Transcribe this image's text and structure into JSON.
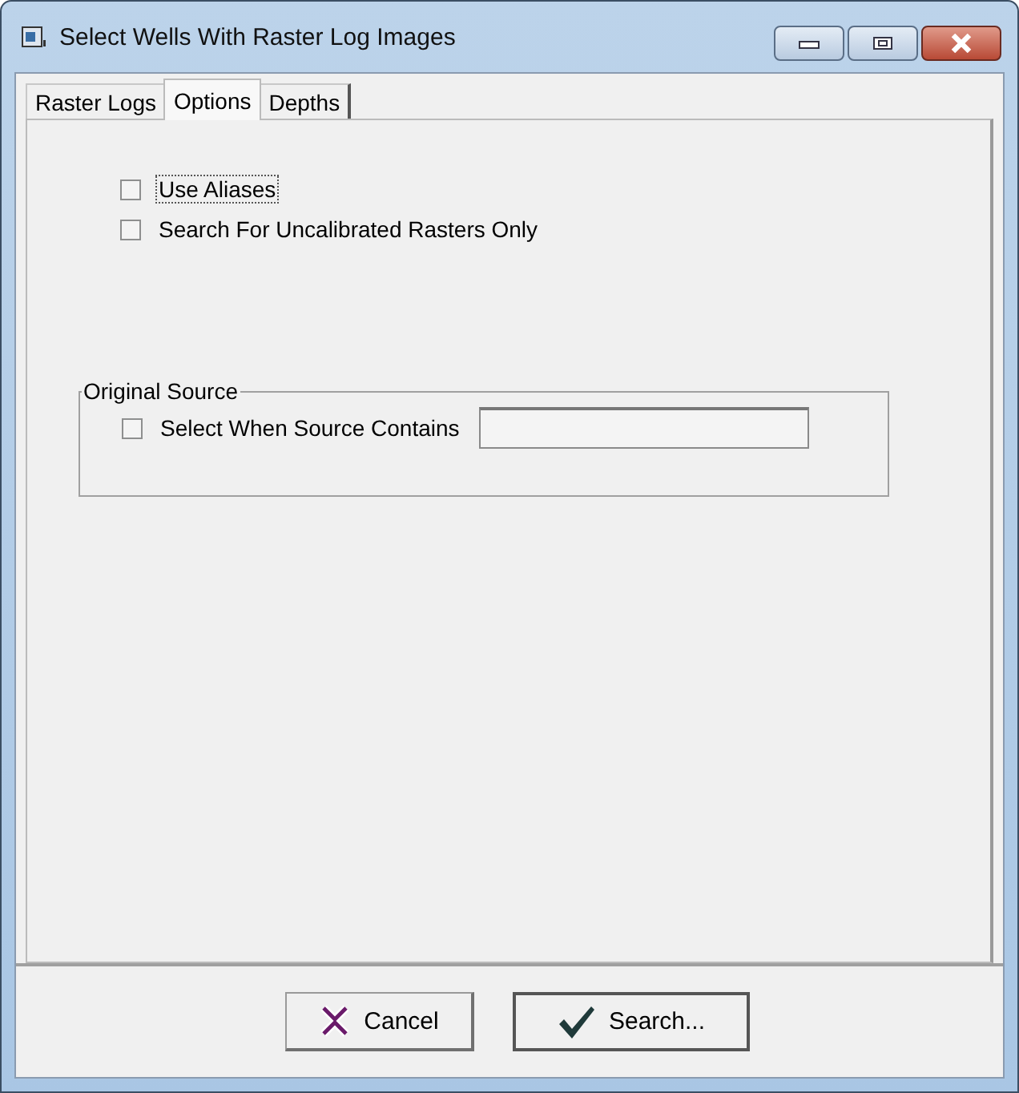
{
  "window": {
    "title": "Select Wells With Raster Log Images"
  },
  "tabs": [
    {
      "label": "Raster Logs",
      "selected": false
    },
    {
      "label": "Options",
      "selected": true
    },
    {
      "label": "Depths",
      "selected": false
    }
  ],
  "options": [
    {
      "label": "Use Aliases",
      "checked": false,
      "focused": true
    },
    {
      "label": "Search For Uncalibrated Rasters Only",
      "checked": false,
      "focused": false
    }
  ],
  "original_source": {
    "title": "Original Source",
    "checkbox": {
      "label": "Select When Source Contains",
      "checked": false
    }
  },
  "buttons": [
    {
      "label": "Cancel",
      "kind": "cancel"
    },
    {
      "label": "Search...",
      "kind": "search"
    }
  ]
}
